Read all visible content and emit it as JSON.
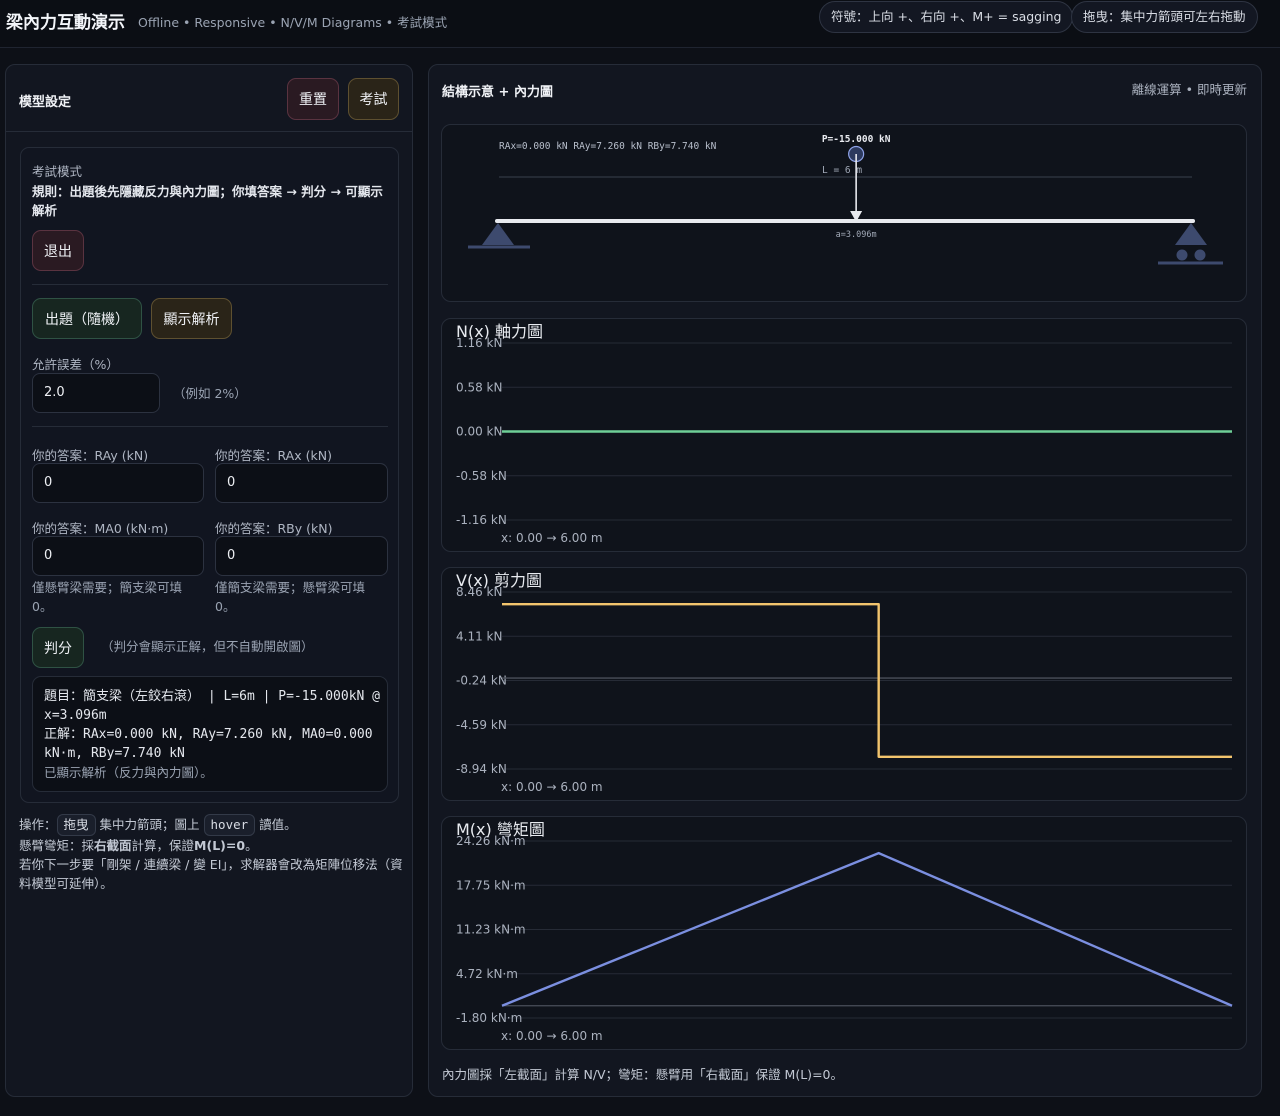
{
  "header": {
    "title": "梁內力互動演示",
    "subtitle": "Offline • Responsive • N/V/M Diagrams • 考試模式",
    "pill_sign": "符號：上向 +、右向 +、M+ = sagging",
    "pill_drag": "拖曳：集中力箭頭可左右拖動"
  },
  "left_panel": {
    "title": "模型設定",
    "reset_label": "重置",
    "exam_label": "考試",
    "exam": {
      "heading": "考試模式",
      "rule": "規則：出題後先隱藏反力與內力圖；你填答案 → 判分 → 可顯示解析",
      "exit_label": "退出",
      "generate_label": "出題（隨機）",
      "show_solution_label": "顯示解析",
      "tolerance_label": "允許誤差（%）",
      "tolerance_value": "2.0",
      "tolerance_hint": "（例如 2%）",
      "answers": [
        {
          "label": "你的答案：RAy (kN)",
          "value": "0"
        },
        {
          "label": "你的答案：RAx (kN)",
          "value": "0"
        },
        {
          "label": "你的答案：MA0 (kN·m)",
          "value": "0"
        },
        {
          "label": "你的答案：RBy (kN)",
          "value": "0"
        }
      ],
      "note_cantilever": "僅懸臂梁需要；簡支梁可填 0。",
      "note_simple": "僅簡支梁需要；懸臂梁可填 0。",
      "grade_label": "判分",
      "grade_hint": "（判分會顯示正解，但不自動開啟圖）",
      "result_problem": "題目：簡支梁（左鉸右滾） | L=6m | P=-15.000kN @ x=3.096m",
      "result_answer": "正解：RAx=0.000 kN, RAy=7.260 kN, MA0=0.000 kN·m, RBy=7.740 kN",
      "result_status": "已顯示解析（反力與內力圖）。"
    },
    "footer": {
      "ops_prefix": "操作：",
      "drag_chip": "拖曳",
      "ops_mid": "集中力箭頭；圖上",
      "hover_chip": "hover",
      "ops_suffix": "讀值。",
      "line2_prefix": "懸臂彎矩：採",
      "line2_bold1": "右截面",
      "line2_mid": "計算，保證",
      "line2_bold2": "M(L)=0",
      "line2_suffix": "。",
      "line3": "若你下一步要「剛架 / 連續梁 / 變 EI」，求解器會改為矩陣位移法（資料模型可延伸）。"
    }
  },
  "right_panel": {
    "title": "結構示意 + 內力圖",
    "status": "離線運算 • 即時更新",
    "structure": {
      "reactions_text": "RAx=0.000 kN RAy=7.260 kN RBy=7.740 kN",
      "load_label": "P=-15.000 kN",
      "length_label": "L = 6 m",
      "position_label": "a=3.096m",
      "length_m": 6,
      "load_position_m": 3.096
    },
    "footer_note": "內力圖採「左截面」計算 N/V；彎矩：懸臂用「右截面」保證 M(L)=0。"
  },
  "chart_data": [
    {
      "type": "line",
      "title": "N(x) 軸力圖",
      "x_range_label": "x: 0.00 → 6.00 m",
      "y_ticks": [
        "1.16 kN",
        "0.58 kN",
        "0.00 kN",
        "-0.58 kN",
        "-1.16 kN"
      ],
      "ylim": [
        -1.16,
        1.16
      ],
      "xlim": [
        0,
        6
      ],
      "color": "#6fcf97",
      "x": [
        0,
        6
      ],
      "y": [
        0,
        0
      ]
    },
    {
      "type": "line",
      "title": "V(x) 剪力圖",
      "x_range_label": "x: 0.00 → 6.00 m",
      "y_ticks": [
        "8.46 kN",
        "4.11 kN",
        "-0.24 kN",
        "-4.59 kN",
        "-8.94 kN"
      ],
      "ylim": [
        -8.94,
        8.46
      ],
      "xlim": [
        0,
        6
      ],
      "color": "#f2c46d",
      "x": [
        0,
        3.096,
        3.096,
        6
      ],
      "y": [
        7.26,
        7.26,
        -7.74,
        -7.74
      ]
    },
    {
      "type": "line",
      "title": "M(x) 彎矩圖",
      "x_range_label": "x: 0.00 → 6.00 m",
      "y_ticks": [
        "24.26 kN·m",
        "17.75 kN·m",
        "11.23 kN·m",
        "4.72 kN·m",
        "-1.80 kN·m"
      ],
      "ylim": [
        -1.8,
        24.26
      ],
      "xlim": [
        0,
        6
      ],
      "color": "#7b8fe0",
      "x": [
        0,
        3.096,
        6
      ],
      "y": [
        0,
        22.477,
        0
      ]
    }
  ]
}
